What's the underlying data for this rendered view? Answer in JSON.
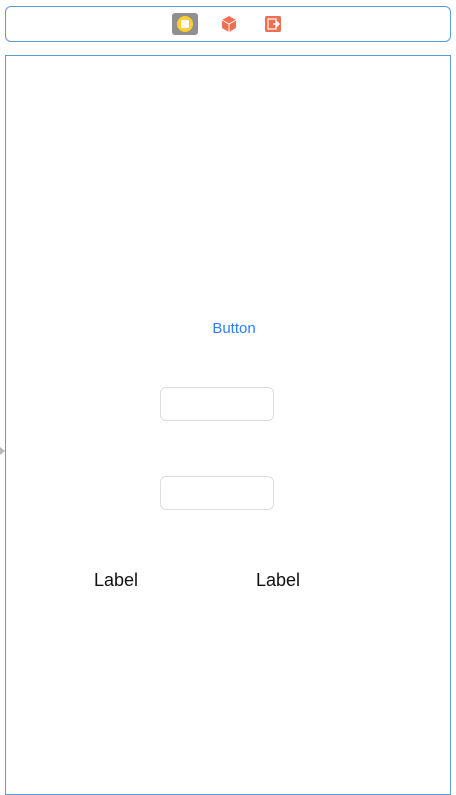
{
  "scene_dock": {
    "icons": [
      "view-controller-icon",
      "first-responder-cube-icon",
      "exit-icon"
    ]
  },
  "scene": {
    "button_title": "Button",
    "label1_text": "Label",
    "label2_text": "Label"
  },
  "colors": {
    "selection_border": "#5b9bd5",
    "button_tint": "#2f7ef6",
    "view_controller_yellow": "#ffce33",
    "storyboard_orange": "#f26e50"
  }
}
